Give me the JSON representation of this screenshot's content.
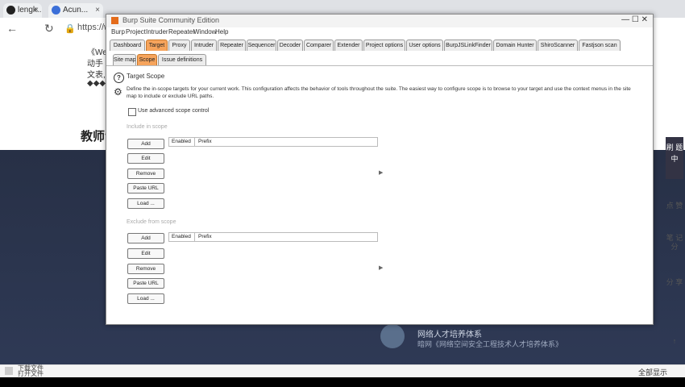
{
  "browser": {
    "tabs": [
      {
        "label": "lengk..."
      },
      {
        "label": "Acun..."
      }
    ],
    "url_fragment": "https://w...",
    "page_snippets": [
      "《Webs",
      "动手",
      "文表,",
      "◆◆◆"
    ],
    "page_heading": "教师专",
    "sidebar": {
      "dark_label": "刷 题 中",
      "items": [
        "点 赞",
        "笔 记 分",
        "分 享"
      ]
    },
    "hero": {
      "line1": "网络人才培养体系",
      "line2": "暗网《网络空间安全工程技术人才培养体系》"
    },
    "download": {
      "label1": "下载文件",
      "label2": "打开文件",
      "right_text": "全部显示"
    }
  },
  "burp": {
    "title": "Burp Suite Community Edition",
    "menu": [
      "Burp",
      "Project",
      "Intruder",
      "Repeater",
      "Window",
      "Help"
    ],
    "tabs": [
      "Dashboard",
      "Target",
      "Proxy",
      "Intruder",
      "Repeater",
      "Sequencer",
      "Decoder",
      "Comparer",
      "Extender",
      "Project options",
      "User options",
      "BurpJSLinkFinder",
      "Domain Hunter",
      "ShiroScanner",
      "Fastjson scan"
    ],
    "active_tab": "Target",
    "subtabs": [
      "Site map",
      "Scope",
      "Issue definitions"
    ],
    "active_subtab": "Scope",
    "section_title": "Target Scope",
    "description": "Define the in-scope targets for your current work. This configuration affects the behavior of tools throughout the suite. The easiest way to configure scope is to browse to your target and use the context menus in the site map to include or exclude URL paths.",
    "advanced_label": "Use advanced scope control",
    "include": {
      "label": "Include in scope",
      "buttons": [
        "Add",
        "Edit",
        "Remove",
        "Paste URL",
        "Load ..."
      ],
      "columns": [
        "Enabled",
        "Prefix"
      ]
    },
    "exclude": {
      "label": "Exclude from scope",
      "buttons": [
        "Add",
        "Edit",
        "Remove",
        "Paste URL",
        "Load ..."
      ],
      "columns": [
        "Enabled",
        "Prefix"
      ]
    }
  }
}
